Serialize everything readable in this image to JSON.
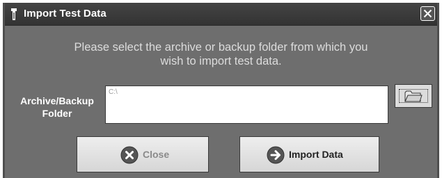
{
  "window": {
    "title": "Import Test Data"
  },
  "prompt": {
    "line1": "Please select the archive or backup folder from which you",
    "line2": "wish to import test data."
  },
  "folder": {
    "label_line1": "Archive/Backup",
    "label_line2": "Folder",
    "value": "C:\\",
    "browse_icon": "folder-icon"
  },
  "buttons": {
    "close_label": "Close",
    "close_icon": "x-circle-icon",
    "import_label": "Import Data",
    "import_icon": "arrow-right-circle-icon"
  },
  "colors": {
    "title_bar": "#383838",
    "dialog_background": "#6e6e6e",
    "prompt_text": "#dcdcdc"
  }
}
